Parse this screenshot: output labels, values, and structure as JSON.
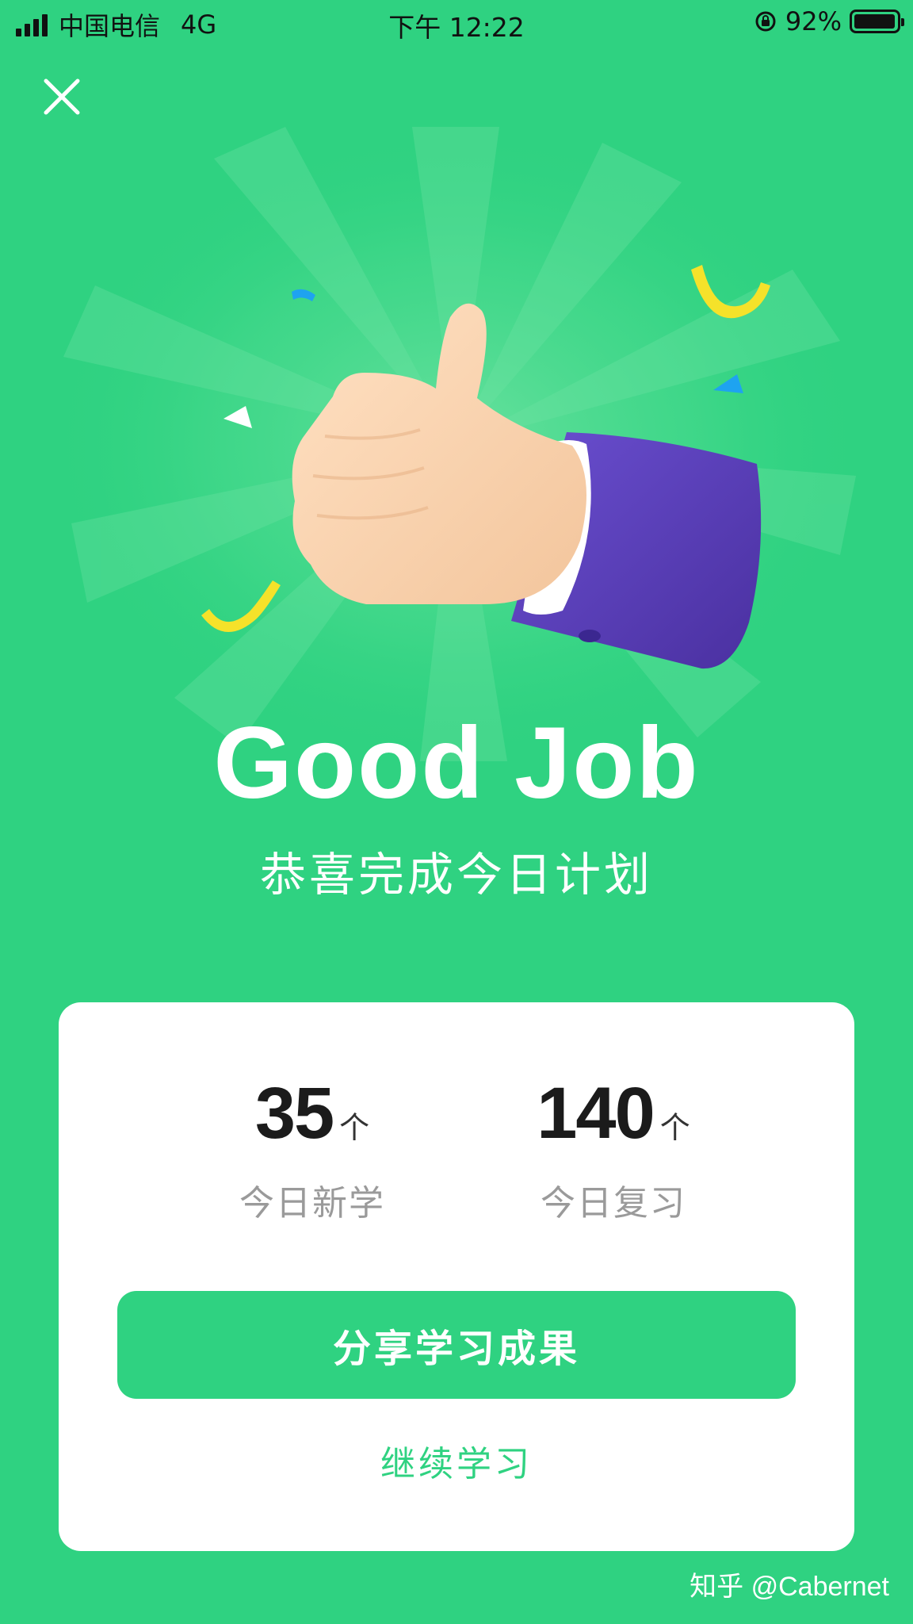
{
  "status_bar": {
    "carrier": "中国电信",
    "network": "4G",
    "time": "下午 12:22",
    "battery": "92%"
  },
  "hero": {
    "title": "Good Job",
    "subtitle": "恭喜完成今日计划"
  },
  "stats": [
    {
      "value": "35",
      "unit": "个",
      "label": "今日新学"
    },
    {
      "value": "140",
      "unit": "个",
      "label": "今日复习"
    }
  ],
  "actions": {
    "share_label": "分享学习成果",
    "continue_label": "继续学习"
  },
  "watermark": "知乎 @Cabernet",
  "colors": {
    "brand_green": "#2fd281",
    "card_bg": "#ffffff",
    "sleeve_purple": "#5a3fb8",
    "confetti_yellow": "#f5e22a",
    "confetti_blue": "#1ea3f0"
  }
}
